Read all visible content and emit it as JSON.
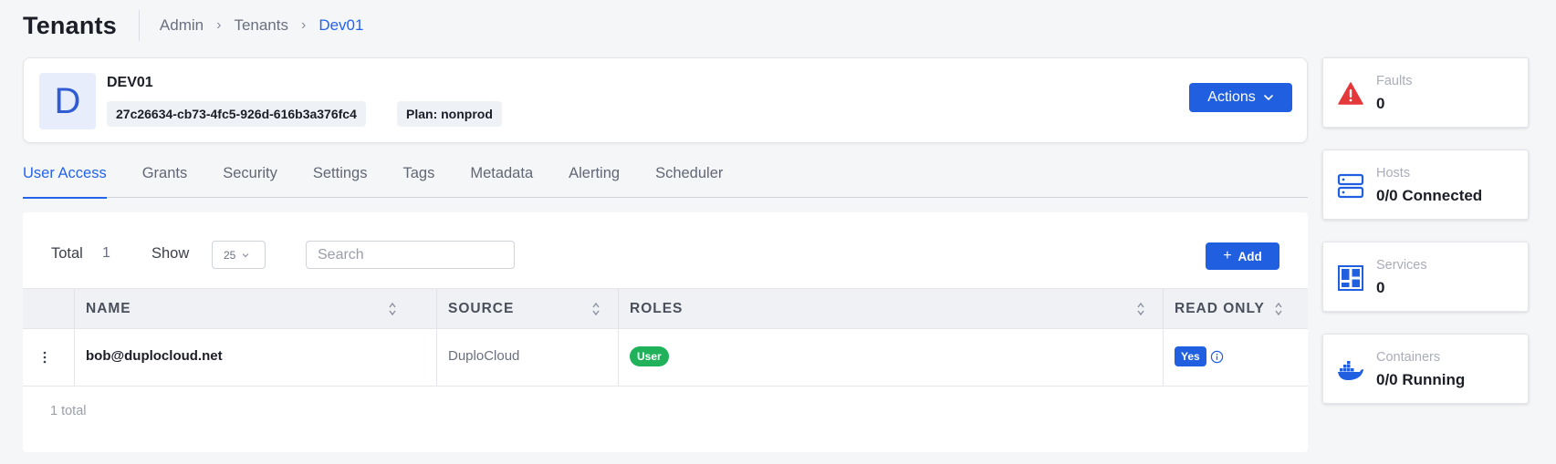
{
  "header": {
    "title": "Tenants",
    "breadcrumb": [
      "Admin",
      "Tenants",
      "Dev01"
    ]
  },
  "tenant": {
    "avatar_letter": "D",
    "name": "DEV01",
    "id": "27c26634-cb73-4fc5-926d-616b3a376fc4",
    "plan": "Plan: nonprod",
    "actions_label": "Actions"
  },
  "tabs": [
    {
      "label": "User Access",
      "active": true
    },
    {
      "label": "Grants"
    },
    {
      "label": "Security"
    },
    {
      "label": "Settings"
    },
    {
      "label": "Tags"
    },
    {
      "label": "Metadata"
    },
    {
      "label": "Alerting"
    },
    {
      "label": "Scheduler"
    }
  ],
  "toolbar": {
    "total_label": "Total",
    "total_value": "1",
    "show_label": "Show",
    "show_value": "25",
    "search_placeholder": "Search",
    "add_label": "Add"
  },
  "table": {
    "columns": [
      "NAME",
      "SOURCE",
      "ROLES",
      "READ ONLY"
    ],
    "rows": [
      {
        "name": "bob@duplocloud.net",
        "source": "DuploCloud",
        "role": "User",
        "read_only": "Yes"
      }
    ],
    "footer": "1 total"
  },
  "stats": [
    {
      "label": "Faults",
      "value": "0",
      "icon": "warning-icon"
    },
    {
      "label": "Hosts",
      "value": "0/0 Connected",
      "icon": "server-icon"
    },
    {
      "label": "Services",
      "value": "0",
      "icon": "grid-icon"
    },
    {
      "label": "Containers",
      "value": "0/0 Running",
      "icon": "docker-icon"
    }
  ],
  "colors": {
    "accent": "#1f5fe0",
    "link": "#2563eb",
    "success": "#20b25a",
    "danger": "#e5383b"
  }
}
